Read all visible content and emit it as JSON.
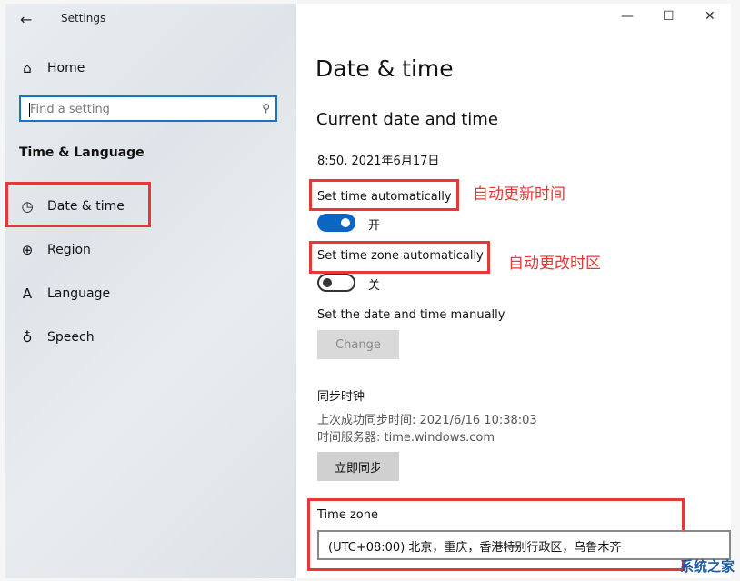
{
  "app": {
    "title": "Settings",
    "back_icon": "back-arrow-icon"
  },
  "sidebar": {
    "home_label": "Home",
    "search_placeholder": "Find a setting",
    "section_title": "Time & Language",
    "items": [
      {
        "label": "Date & time",
        "icon": "clock-calendar-icon"
      },
      {
        "label": "Region",
        "icon": "globe-icon"
      },
      {
        "label": "Language",
        "icon": "language-icon"
      },
      {
        "label": "Speech",
        "icon": "microphone-icon"
      }
    ]
  },
  "window_controls": {
    "minimize": "—",
    "maximize": "☐",
    "close": "✕"
  },
  "main": {
    "page_title": "Date & time",
    "section_title": "Current date and time",
    "current_datetime": "8:50, 2021年6月17日",
    "set_time_auto_label": "Set time automatically",
    "set_time_auto_state": "开",
    "set_timezone_auto_label": "Set time zone automatically",
    "set_timezone_auto_state": "关",
    "manual_label": "Set the date and time manually",
    "change_button": "Change",
    "sync_title": "同步时钟",
    "last_sync": "上次成功同步时间: 2021/6/16 10:38:03",
    "time_server": "时间服务器: time.windows.com",
    "sync_now_button": "立即同步",
    "time_zone_label": "Time zone",
    "time_zone_value": "(UTC+08:00) 北京，重庆，香港特别行政区，乌鲁木齐"
  },
  "annotations": {
    "note_auto_time": "自动更新时间",
    "note_auto_timezone": "自动更改时区",
    "color": "#e53935"
  },
  "watermark": {
    "text": "系统之家"
  },
  "colors": {
    "accent": "#0a66c2",
    "annotation_red": "#e53935"
  }
}
